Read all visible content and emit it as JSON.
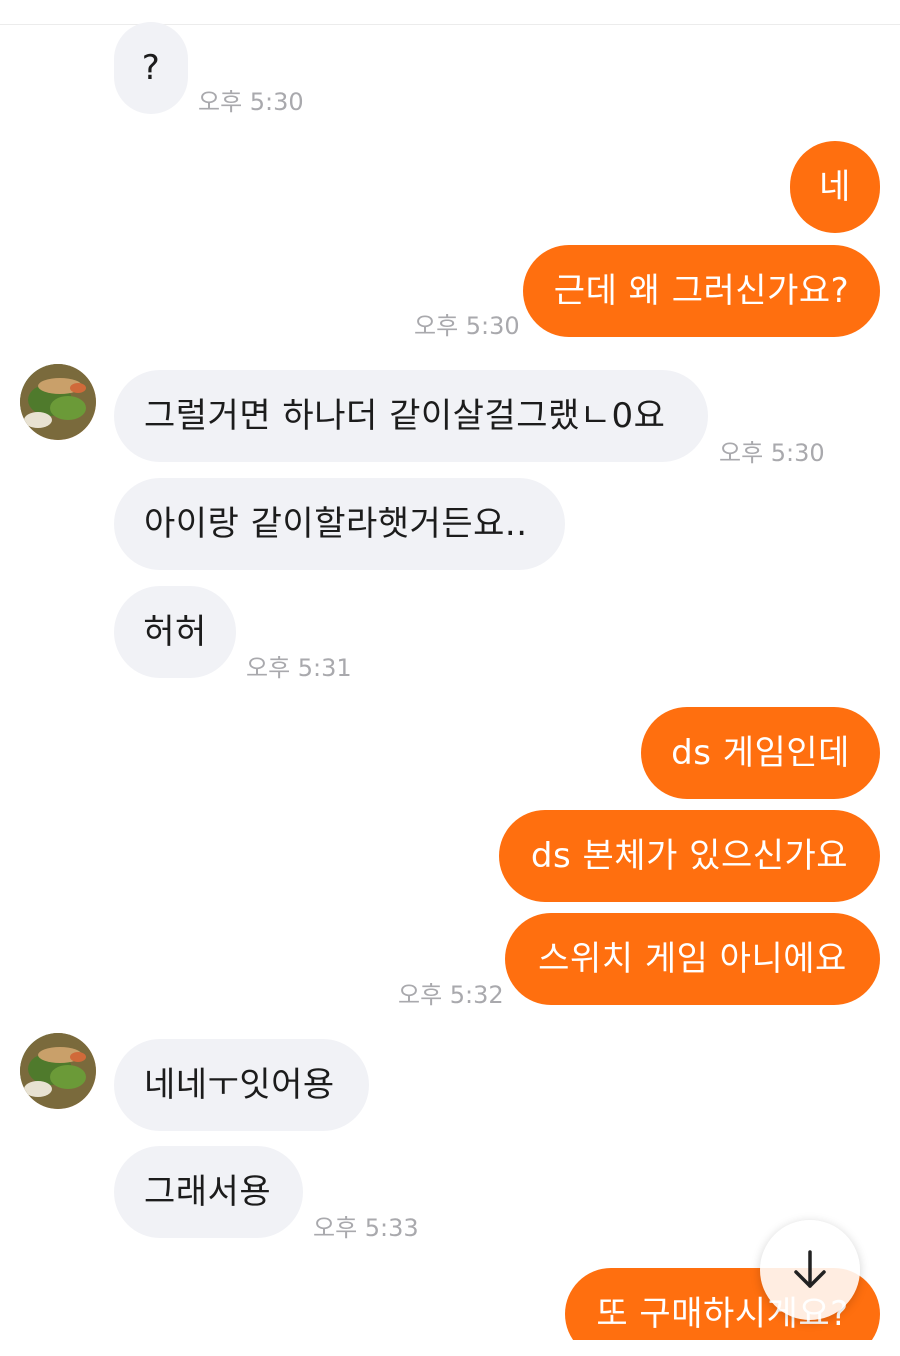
{
  "messages": [
    {
      "side": "in",
      "text": "?",
      "time": "오후 5:30"
    },
    {
      "side": "out",
      "text": "네"
    },
    {
      "side": "out",
      "text": "근데 왜 그러신가요?",
      "time": "오후 5:30"
    },
    {
      "side": "in",
      "text": "그럴거면 하나더 같이살걸그랬ㄴ0요",
      "time": "오후 5:30"
    },
    {
      "side": "in",
      "text": "아이랑 같이할라햇거든요.."
    },
    {
      "side": "in",
      "text": "허허",
      "time": "오후 5:31"
    },
    {
      "side": "out",
      "text": "ds 게임인데"
    },
    {
      "side": "out",
      "text": "ds 본체가 있으신가요"
    },
    {
      "side": "out",
      "text": "스위치 게임 아니에요",
      "time": "오후 5:32"
    },
    {
      "side": "in",
      "text": "네네ㅜ잇어용"
    },
    {
      "side": "in",
      "text": "그래서용",
      "time": "오후 5:33"
    },
    {
      "side": "out",
      "text": "또 구매하시게요?"
    }
  ],
  "colors": {
    "outgoing_bubble": "#ff6f0f",
    "incoming_bubble": "#f1f2f6",
    "timestamp": "#a9a9ad"
  },
  "icons": {
    "scroll_down": "arrow-down-icon",
    "avatar": "user-avatar"
  }
}
